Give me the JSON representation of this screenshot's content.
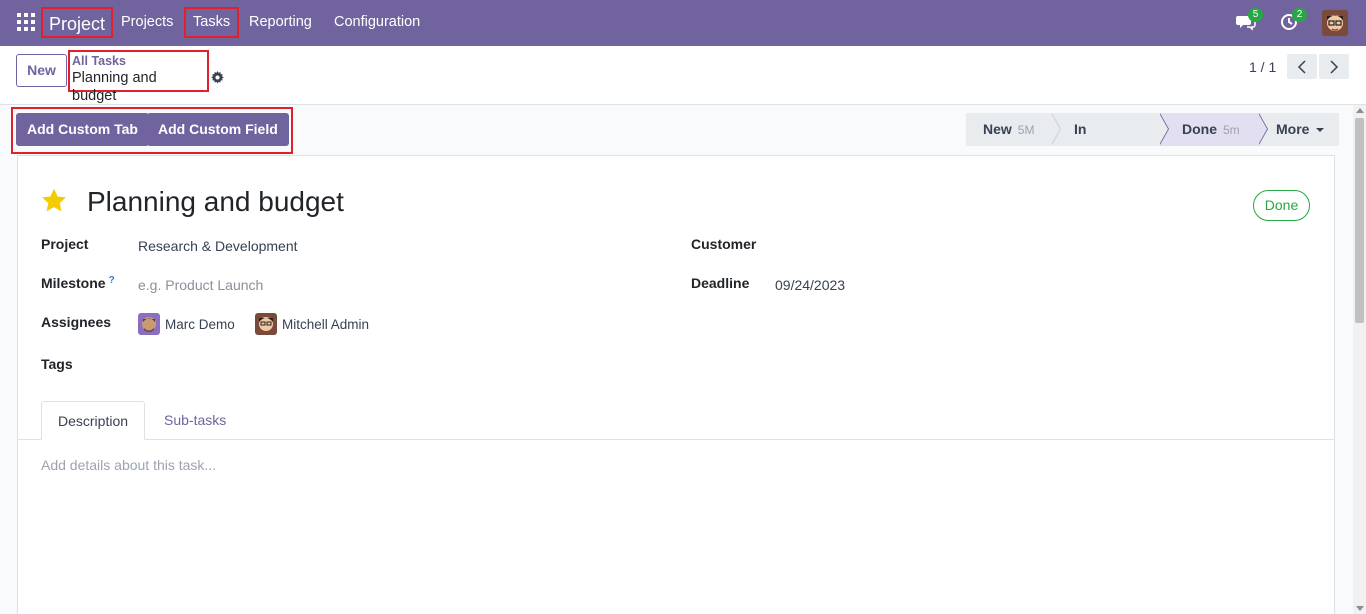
{
  "navbar": {
    "brand": "Project",
    "items": [
      {
        "label": "Projects"
      },
      {
        "label": "Tasks"
      },
      {
        "label": "Reporting"
      },
      {
        "label": "Configuration"
      }
    ],
    "messages_count": "5",
    "activities_count": "2",
    "color": "#71639e"
  },
  "control": {
    "new_label": "New",
    "breadcrumb_parent": "All Tasks",
    "breadcrumb_current": "Planning and budget",
    "pager": "1 / 1"
  },
  "actions": {
    "add_tab": "Add Custom Tab",
    "add_field": "Add Custom Field"
  },
  "stages": [
    {
      "label": "New",
      "duration": "5M"
    },
    {
      "label": "In Progress",
      "duration": ""
    },
    {
      "label": "Done",
      "duration": "5m",
      "active": true
    },
    {
      "label": "More"
    }
  ],
  "task": {
    "title": "Planning and budget",
    "status": "Done",
    "starred": true
  },
  "fields": {
    "project_label": "Project",
    "project_value": "Research & Development",
    "milestone_label": "Milestone",
    "milestone_help": "?",
    "milestone_placeholder": "e.g. Product Launch",
    "assignees_label": "Assignees",
    "assignees": [
      {
        "name": "Marc Demo"
      },
      {
        "name": "Mitchell Admin"
      }
    ],
    "tags_label": "Tags",
    "customer_label": "Customer",
    "deadline_label": "Deadline",
    "deadline_value": "09/24/2023"
  },
  "tabs": [
    {
      "label": "Description",
      "active": true
    },
    {
      "label": "Sub-tasks",
      "active": false
    }
  ],
  "description_placeholder": "Add details about this task..."
}
